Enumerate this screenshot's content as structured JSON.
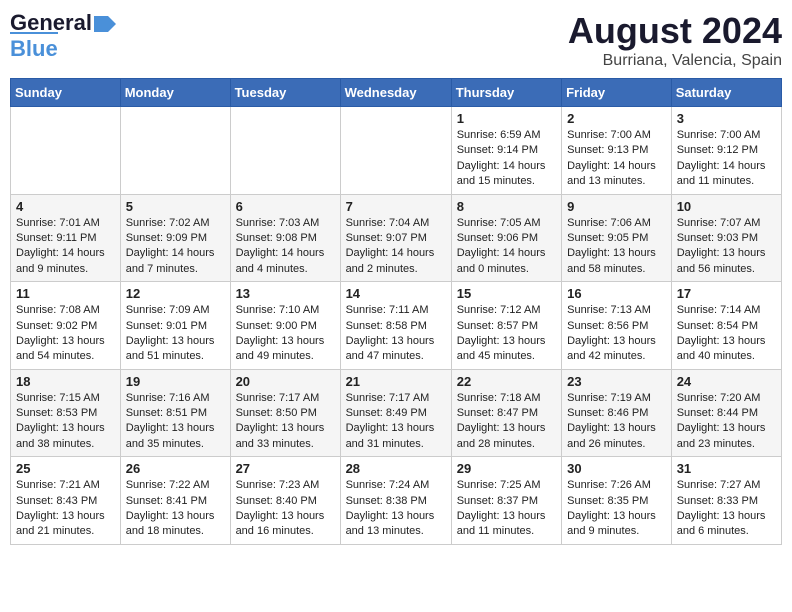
{
  "header": {
    "logo_line1": "General",
    "logo_line2": "Blue",
    "title": "August 2024",
    "subtitle": "Burriana, Valencia, Spain"
  },
  "calendar": {
    "days_of_week": [
      "Sunday",
      "Monday",
      "Tuesday",
      "Wednesday",
      "Thursday",
      "Friday",
      "Saturday"
    ],
    "weeks": [
      [
        {
          "day": "",
          "content": ""
        },
        {
          "day": "",
          "content": ""
        },
        {
          "day": "",
          "content": ""
        },
        {
          "day": "",
          "content": ""
        },
        {
          "day": "1",
          "content": "Sunrise: 6:59 AM\nSunset: 9:14 PM\nDaylight: 14 hours\nand 15 minutes."
        },
        {
          "day": "2",
          "content": "Sunrise: 7:00 AM\nSunset: 9:13 PM\nDaylight: 14 hours\nand 13 minutes."
        },
        {
          "day": "3",
          "content": "Sunrise: 7:00 AM\nSunset: 9:12 PM\nDaylight: 14 hours\nand 11 minutes."
        }
      ],
      [
        {
          "day": "4",
          "content": "Sunrise: 7:01 AM\nSunset: 9:11 PM\nDaylight: 14 hours\nand 9 minutes."
        },
        {
          "day": "5",
          "content": "Sunrise: 7:02 AM\nSunset: 9:09 PM\nDaylight: 14 hours\nand 7 minutes."
        },
        {
          "day": "6",
          "content": "Sunrise: 7:03 AM\nSunset: 9:08 PM\nDaylight: 14 hours\nand 4 minutes."
        },
        {
          "day": "7",
          "content": "Sunrise: 7:04 AM\nSunset: 9:07 PM\nDaylight: 14 hours\nand 2 minutes."
        },
        {
          "day": "8",
          "content": "Sunrise: 7:05 AM\nSunset: 9:06 PM\nDaylight: 14 hours\nand 0 minutes."
        },
        {
          "day": "9",
          "content": "Sunrise: 7:06 AM\nSunset: 9:05 PM\nDaylight: 13 hours\nand 58 minutes."
        },
        {
          "day": "10",
          "content": "Sunrise: 7:07 AM\nSunset: 9:03 PM\nDaylight: 13 hours\nand 56 minutes."
        }
      ],
      [
        {
          "day": "11",
          "content": "Sunrise: 7:08 AM\nSunset: 9:02 PM\nDaylight: 13 hours\nand 54 minutes."
        },
        {
          "day": "12",
          "content": "Sunrise: 7:09 AM\nSunset: 9:01 PM\nDaylight: 13 hours\nand 51 minutes."
        },
        {
          "day": "13",
          "content": "Sunrise: 7:10 AM\nSunset: 9:00 PM\nDaylight: 13 hours\nand 49 minutes."
        },
        {
          "day": "14",
          "content": "Sunrise: 7:11 AM\nSunset: 8:58 PM\nDaylight: 13 hours\nand 47 minutes."
        },
        {
          "day": "15",
          "content": "Sunrise: 7:12 AM\nSunset: 8:57 PM\nDaylight: 13 hours\nand 45 minutes."
        },
        {
          "day": "16",
          "content": "Sunrise: 7:13 AM\nSunset: 8:56 PM\nDaylight: 13 hours\nand 42 minutes."
        },
        {
          "day": "17",
          "content": "Sunrise: 7:14 AM\nSunset: 8:54 PM\nDaylight: 13 hours\nand 40 minutes."
        }
      ],
      [
        {
          "day": "18",
          "content": "Sunrise: 7:15 AM\nSunset: 8:53 PM\nDaylight: 13 hours\nand 38 minutes."
        },
        {
          "day": "19",
          "content": "Sunrise: 7:16 AM\nSunset: 8:51 PM\nDaylight: 13 hours\nand 35 minutes."
        },
        {
          "day": "20",
          "content": "Sunrise: 7:17 AM\nSunset: 8:50 PM\nDaylight: 13 hours\nand 33 minutes."
        },
        {
          "day": "21",
          "content": "Sunrise: 7:17 AM\nSunset: 8:49 PM\nDaylight: 13 hours\nand 31 minutes."
        },
        {
          "day": "22",
          "content": "Sunrise: 7:18 AM\nSunset: 8:47 PM\nDaylight: 13 hours\nand 28 minutes."
        },
        {
          "day": "23",
          "content": "Sunrise: 7:19 AM\nSunset: 8:46 PM\nDaylight: 13 hours\nand 26 minutes."
        },
        {
          "day": "24",
          "content": "Sunrise: 7:20 AM\nSunset: 8:44 PM\nDaylight: 13 hours\nand 23 minutes."
        }
      ],
      [
        {
          "day": "25",
          "content": "Sunrise: 7:21 AM\nSunset: 8:43 PM\nDaylight: 13 hours\nand 21 minutes."
        },
        {
          "day": "26",
          "content": "Sunrise: 7:22 AM\nSunset: 8:41 PM\nDaylight: 13 hours\nand 18 minutes."
        },
        {
          "day": "27",
          "content": "Sunrise: 7:23 AM\nSunset: 8:40 PM\nDaylight: 13 hours\nand 16 minutes."
        },
        {
          "day": "28",
          "content": "Sunrise: 7:24 AM\nSunset: 8:38 PM\nDaylight: 13 hours\nand 13 minutes."
        },
        {
          "day": "29",
          "content": "Sunrise: 7:25 AM\nSunset: 8:37 PM\nDaylight: 13 hours\nand 11 minutes."
        },
        {
          "day": "30",
          "content": "Sunrise: 7:26 AM\nSunset: 8:35 PM\nDaylight: 13 hours\nand 9 minutes."
        },
        {
          "day": "31",
          "content": "Sunrise: 7:27 AM\nSunset: 8:33 PM\nDaylight: 13 hours\nand 6 minutes."
        }
      ]
    ]
  }
}
